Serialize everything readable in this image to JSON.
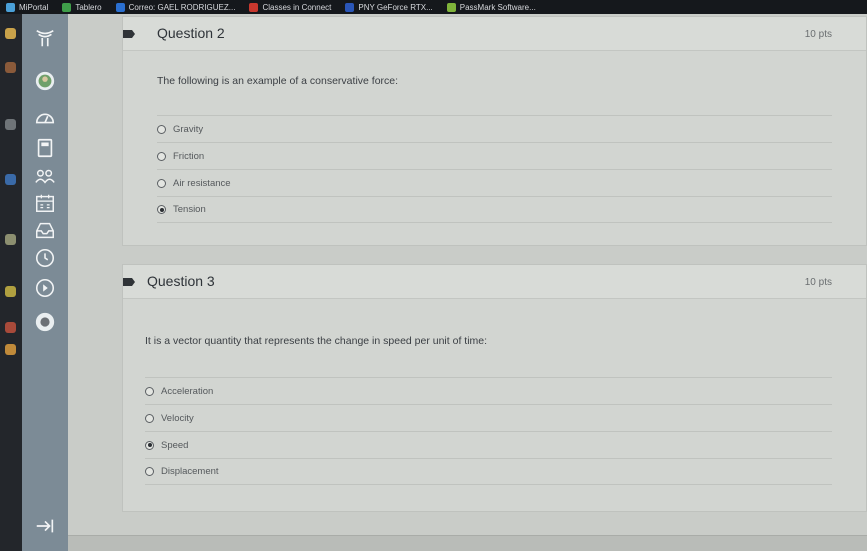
{
  "bookmarks": [
    {
      "label": "MiPortal",
      "color": "#4aa0d8"
    },
    {
      "label": "Tablero",
      "color": "#3f9e4a"
    },
    {
      "label": "Correo: GAEL RODRIGUEZ...",
      "color": "#2a6fd0"
    },
    {
      "label": "Classes in Connect",
      "color": "#c8382e"
    },
    {
      "label": "PNY GeForce RTX...",
      "color": "#2a56b8"
    },
    {
      "label": "PassMark Software...",
      "color": "#7fb33a"
    }
  ],
  "nav": {
    "items": [
      {
        "name": "logo-icon"
      },
      {
        "name": "account-icon"
      },
      {
        "name": "dashboard-icon"
      },
      {
        "name": "courses-icon"
      },
      {
        "name": "groups-icon"
      },
      {
        "name": "calendar-icon"
      },
      {
        "name": "inbox-icon"
      },
      {
        "name": "history-icon"
      },
      {
        "name": "studio-icon"
      },
      {
        "name": "help-icon"
      }
    ],
    "collapse_icon": "collapse-arrow-icon"
  },
  "questions": [
    {
      "title": "Question 2",
      "points": "10 pts",
      "text": "The following is an example of a conservative force:",
      "answers": [
        {
          "label": "Gravity",
          "selected": false
        },
        {
          "label": "Friction",
          "selected": false
        },
        {
          "label": "Air resistance",
          "selected": false
        },
        {
          "label": "Tension",
          "selected": true
        }
      ]
    },
    {
      "title": "Question 3",
      "points": "10 pts",
      "text": "It is a vector quantity that represents the change in speed per unit of time:",
      "answers": [
        {
          "label": "Acceleration",
          "selected": false
        },
        {
          "label": "Velocity",
          "selected": false
        },
        {
          "label": "Speed",
          "selected": true
        },
        {
          "label": "Displacement",
          "selected": false
        }
      ]
    }
  ],
  "colors": {
    "nav": "#7c8b96",
    "content": "#c9ccc8"
  }
}
